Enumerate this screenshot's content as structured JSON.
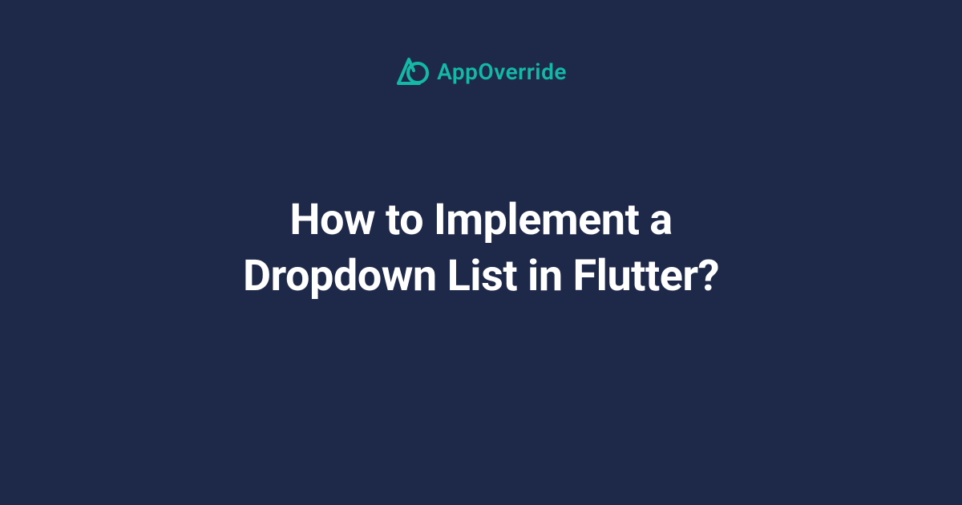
{
  "brand": {
    "name": "AppOverride",
    "accent_color": "#14b8a6"
  },
  "title": {
    "line1": "How to Implement a",
    "line2": "Dropdown List in Flutter?"
  },
  "colors": {
    "background": "#1e2949",
    "text": "#ffffff",
    "accent": "#14b8a6"
  }
}
